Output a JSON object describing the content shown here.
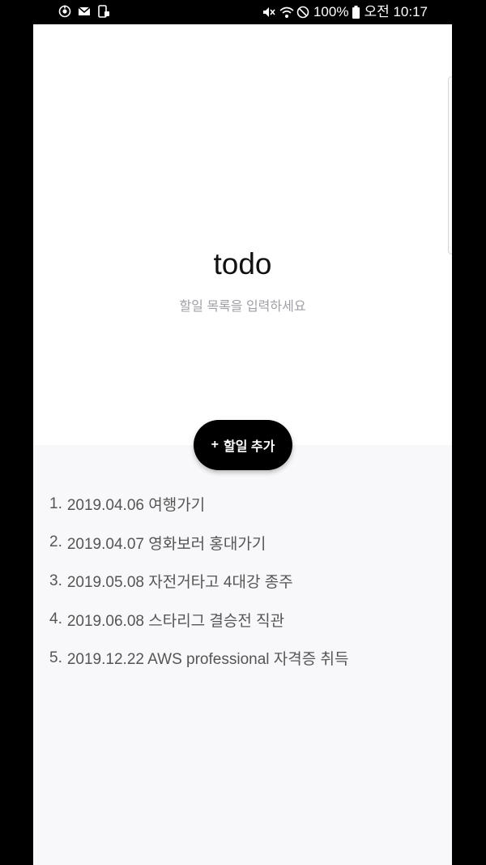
{
  "status_bar": {
    "battery": "100%",
    "time": "오전 10:17",
    "left_icons": [
      "sync-icon",
      "gmail-icon",
      "phone-lock-icon"
    ],
    "right_icons": [
      "mute-icon",
      "wifi-icon",
      "blocked-icon",
      "battery-icon"
    ]
  },
  "header": {
    "title": "todo",
    "subtitle": "할일 목록을 입력하세요"
  },
  "add_button": {
    "icon": "+",
    "label": "할일 추가"
  },
  "todos": [
    {
      "index": "1.",
      "text": "2019.04.06 여행가기"
    },
    {
      "index": "2.",
      "text": "2019.04.07 영화보러 홍대가기"
    },
    {
      "index": "3.",
      "text": "2019.05.08 자전거타고 4대강 종주"
    },
    {
      "index": "4.",
      "text": "2019.06.08 스타리그 결승전 직관"
    },
    {
      "index": "5.",
      "text": "2019.12.22 AWS professional 자격증 취득"
    }
  ],
  "colors": {
    "header_bg": "#ffffff",
    "list_bg": "#f8f8fa",
    "button_bg": "#000000",
    "subtitle": "#a0a0a6",
    "item_text": "#555555"
  }
}
